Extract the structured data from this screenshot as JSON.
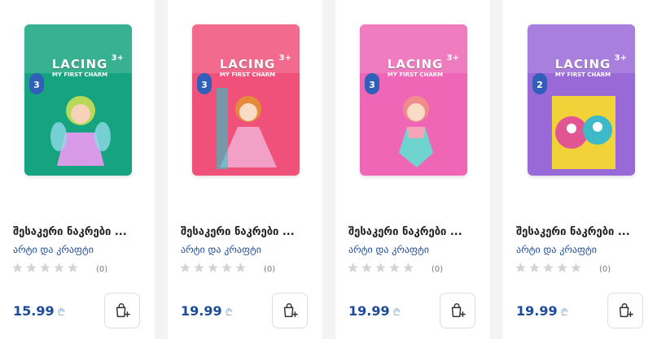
{
  "products": [
    {
      "name": "შესაკერი ნაკრები ...",
      "brand": "არტი და კრაფტი",
      "price": "15.99",
      "currency": "₾",
      "reviews": "(0)",
      "rating": 0,
      "box": {
        "title": "LACING",
        "subtitle": "MY FIRST CHARM",
        "age": "3+",
        "level": "3",
        "color": "#16a37f",
        "accent": "#b7d957",
        "figure": "#d99ae8"
      }
    },
    {
      "name": "შესაკერი ნაკრები ...",
      "brand": "არტი და კრაფტი",
      "price": "19.99",
      "currency": "₾",
      "reviews": "(0)",
      "rating": 0,
      "box": {
        "title": "LACING",
        "subtitle": "MY FIRST CHARM",
        "age": "3+",
        "level": "3",
        "color": "#f0517b",
        "accent": "#2cc6c6",
        "figure": "#f3a0c6"
      }
    },
    {
      "name": "შესაკერი ნაკრები ...",
      "brand": "არტი და კრაფტი",
      "price": "19.99",
      "currency": "₾",
      "reviews": "(0)",
      "rating": 0,
      "box": {
        "title": "LACING",
        "subtitle": "MY FIRST CHARM",
        "age": "3+",
        "level": "3",
        "color": "#ee66b5",
        "accent": "#6fd3ce",
        "figure": "#f6a6b8"
      }
    },
    {
      "name": "შესაკერი ნაკრები ...",
      "brand": "არტი და კრაფტი",
      "price": "19.99",
      "currency": "₾",
      "reviews": "(0)",
      "rating": 0,
      "box": {
        "title": "LACING",
        "subtitle": "MY FIRST CHARM",
        "age": "3+",
        "level": "2",
        "color": "#9a69d8",
        "accent": "#f1d339",
        "figure": "#e25593"
      }
    }
  ],
  "icons": {
    "star": "star-icon",
    "cart": "add-to-cart-icon"
  },
  "colors": {
    "price": "#1d4b9a",
    "star_empty": "#d3d3d3"
  }
}
